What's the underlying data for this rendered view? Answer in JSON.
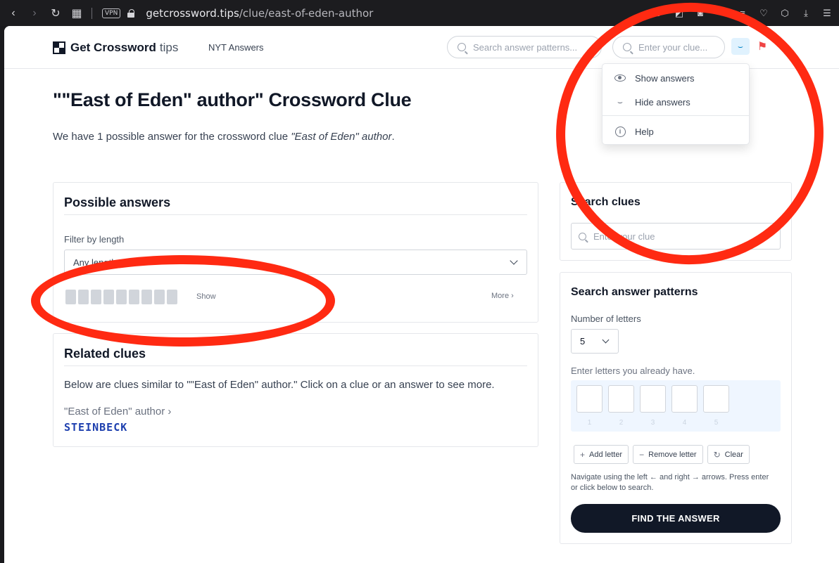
{
  "browser": {
    "url_host": "getcrossword.tips",
    "url_path": "/clue/east-of-eden-author",
    "vpn_label": "VPN"
  },
  "header": {
    "brand": "Get Crossword",
    "brand_suffix": "tips",
    "nav_link": "NYT Answers",
    "pattern_search_placeholder": "Search answer patterns...",
    "clue_search_placeholder": "Enter your clue..."
  },
  "menu": {
    "items": [
      {
        "label": "Show answers",
        "icon": "eye-icon"
      },
      {
        "label": "Hide answers",
        "icon": "eye-closed-icon"
      },
      {
        "label": "Help",
        "icon": "info-icon"
      }
    ]
  },
  "page": {
    "title": "\"\"East of Eden\" author\" Crossword Clue",
    "subtitle_prefix": "We have 1 possible answer for the crossword clue ",
    "subtitle_clue": "\"East of Eden\" author",
    "subtitle_suffix": "."
  },
  "possible_answers": {
    "heading": "Possible answers",
    "filter_label": "Filter by length",
    "filter_value": "Any length",
    "answer_length": 9,
    "show_label": "Show",
    "more_label": "More ›"
  },
  "related": {
    "heading": "Related clues",
    "description": "Below are clues similar to \"\"East of Eden\" author.\" Click on a clue or an answer to see more.",
    "clue": "\"East of Eden\" author ›",
    "answer": "STEINBECK"
  },
  "search_clues": {
    "heading": "Search clues",
    "placeholder": "Enter your clue"
  },
  "patterns": {
    "heading": "Search answer patterns",
    "number_label": "Number of letters",
    "number_value": "5",
    "enter_label": "Enter letters you already have.",
    "positions": [
      "1",
      "2",
      "3",
      "4",
      "5"
    ],
    "add_label": "Add letter",
    "remove_label": "Remove letter",
    "clear_label": "Clear",
    "hint": "Navigate using the left ← and right → arrows. Press enter or click below to search.",
    "find_label": "FIND THE ANSWER"
  },
  "colors": {
    "annotation": "#ff2a12",
    "answer_link": "#1e40af",
    "primary_button": "#111827"
  }
}
